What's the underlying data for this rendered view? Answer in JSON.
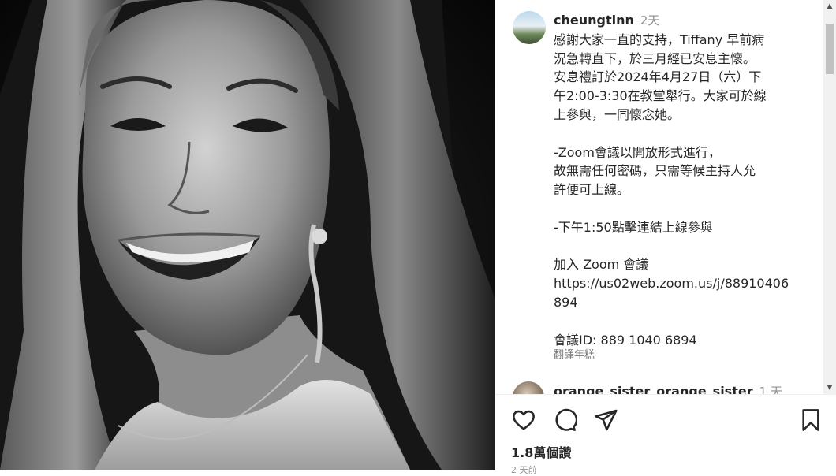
{
  "post": {
    "author": {
      "username": "cheungtinn",
      "time_ago": "2天"
    },
    "caption_lines": [
      "感謝大家一直的支持，Tiffany 早前病",
      "況急轉直下，於三月經已安息主懷。",
      "安息禮訂於2024年4月27日（六）下",
      "午2:00-3:30在教堂舉行。大家可於線",
      "上參與，一同懷念她。",
      "",
      "-Zoom會議以開放形式進行，",
      "故無需任何密碼，只需等候主持人允",
      "許便可上線。",
      "",
      "-下午1:50點擊連結上線參與",
      "",
      "加入 Zoom 會議",
      "https://us02web.zoom.us/j/88910406",
      "894",
      "",
      "會議ID: 889 1040 6894"
    ],
    "translate_label": "翻譯年糕"
  },
  "next_comment": {
    "username": "orange_sister_orange_sister",
    "time_ago": "1 天"
  },
  "actions": {
    "like_icon": "heart-outline-icon",
    "comment_icon": "comment-bubble-icon",
    "share_icon": "paper-plane-icon",
    "save_icon": "bookmark-icon"
  },
  "likes_count": "1.8萬個讚",
  "post_date": "2 天前"
}
